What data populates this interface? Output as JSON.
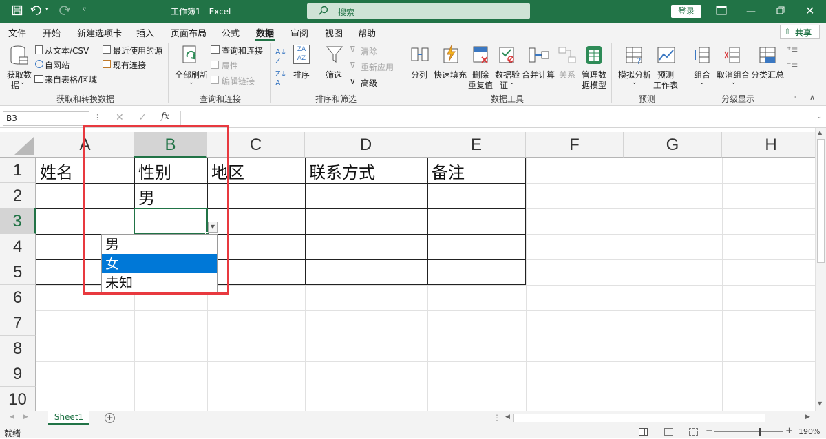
{
  "window": {
    "title": "工作簿1 - Excel",
    "login_label": "登录"
  },
  "search": {
    "placeholder": "搜索"
  },
  "menu": {
    "tabs": [
      "文件",
      "开始",
      "新建选项卡",
      "插入",
      "页面布局",
      "公式",
      "数据",
      "审阅",
      "视图",
      "帮助"
    ],
    "active": "数据",
    "share_label": "共享"
  },
  "ribbon": {
    "get_data": {
      "btn": [
        "获取数",
        "据"
      ],
      "from_text_csv": "从文本/CSV",
      "from_web": "自网站",
      "from_table": "来自表格/区域",
      "recent_sources": "最近使用的源",
      "existing_connections": "现有连接",
      "label": "获取和转换数据"
    },
    "queries": {
      "refresh_all": "全部刷新",
      "queries_connections": "查询和连接",
      "properties": "属性",
      "edit_links": "编辑链接",
      "label": "查询和连接"
    },
    "sort_filter": {
      "sort": "排序",
      "filter": "筛选",
      "clear": "清除",
      "reapply": "重新应用",
      "advanced": "高级",
      "label": "排序和筛选"
    },
    "data_tools": {
      "split": "分列",
      "flash_fill": "快速填充",
      "remove_dup": [
        "删除",
        "重复值"
      ],
      "validation": [
        "数据验",
        "证"
      ],
      "consolidate": "合并计算",
      "relationships": "关系",
      "manage_model": [
        "管理数",
        "据模型"
      ],
      "label": "数据工具"
    },
    "forecast": {
      "what_if": "模拟分析",
      "sheet": [
        "预测",
        "工作表"
      ],
      "label": "预测"
    },
    "outline": {
      "group": "组合",
      "ungroup": "取消组合",
      "subtotal": "分类汇总",
      "label": "分级显示"
    }
  },
  "formula_bar": {
    "name_box": "B3",
    "fx": "fx"
  },
  "sheet": {
    "columns": [
      "A",
      "B",
      "C",
      "D",
      "E",
      "F",
      "G",
      "H"
    ],
    "rows": [
      "1",
      "2",
      "3",
      "4",
      "5",
      "6",
      "7",
      "8",
      "9",
      "10"
    ],
    "cells": {
      "A1": "姓名",
      "B1": "性别",
      "C1": "地区",
      "D1": "联系方式",
      "E1": "备注",
      "B2": "男"
    }
  },
  "dropdown": {
    "options": [
      "男",
      "女",
      "未知"
    ],
    "selected": "女"
  },
  "sheet_tabs": {
    "active": "Sheet1"
  },
  "status": {
    "ready": "就绪",
    "zoom": "190%"
  }
}
